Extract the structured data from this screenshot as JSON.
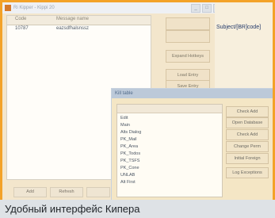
{
  "background_window": {
    "title": "Ri Kipper - Kippi 20",
    "window_controls": [
      "_",
      "□",
      "×"
    ],
    "list_headers": [
      "Code",
      "Message name"
    ],
    "list_row": [
      "10787",
      "eazsdfhalsnssz"
    ],
    "right_text": "Subject/[BR]code]",
    "buttons": [
      "",
      "",
      "Expand Hotkeys",
      "Load Entry",
      "Save Entry"
    ],
    "bottom_buttons": [
      "Add",
      "Refresh",
      ""
    ]
  },
  "dialog": {
    "title": "Kill table",
    "list_items": [
      "Edit",
      "Main",
      "Alts Dialog",
      "PK_Mail",
      "PK_Area",
      "PK_Todos",
      "PK_TSFS",
      "PK_Cone",
      "UNLAB",
      "Alt First"
    ],
    "buttons": [
      "Check Add",
      "Open Database",
      "Check Add",
      "Change Perm",
      "Initial Foreign",
      "Log Exceptions"
    ]
  },
  "caption": "Удобный интерфейс Кипера",
  "colors": {
    "frame": "#f3a228",
    "caption_bg": "#dee2e6"
  }
}
